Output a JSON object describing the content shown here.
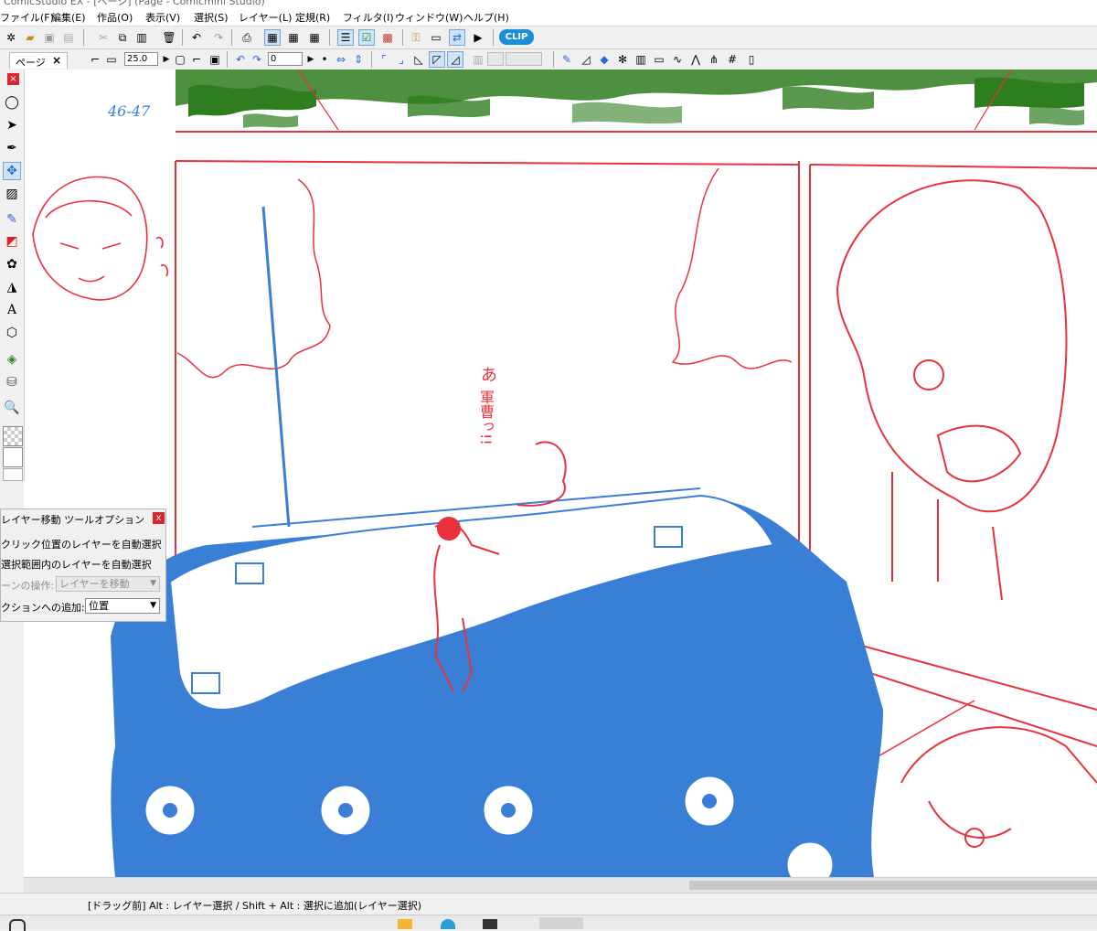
{
  "window": {
    "title": "ComicStudio EX - [ページ] (Page - Comicmini Studio)"
  },
  "menu": [
    "ファイル(F)",
    "編集(E)",
    "作品(O)",
    "表示(V)",
    "選択(S)",
    "レイヤー(L)",
    "定規(R)",
    "フィルタ(I)",
    "ウィンドウ(W)",
    "ヘルプ(H)"
  ],
  "toolbar": {
    "clip_logo": "CLIP"
  },
  "subtoolbar": {
    "zoom_value": "25.0",
    "rotate_value": "0"
  },
  "page_tab": {
    "label": "ページ",
    "close": "×"
  },
  "canvas": {
    "page_note": "46-47",
    "sfx_text_line1": "あ",
    "sfx_text_line2": "軍曹っ!!"
  },
  "tool_options": {
    "title": "レイヤー移動 ツールオプション",
    "close": "x",
    "option1": "クリック位置のレイヤーを自動選択",
    "option2": "選択範囲内のレイヤーを自動選択",
    "field1_label": "ーンの操作:",
    "field1_value": "レイヤーを移動",
    "field2_label": "クションへの追加:",
    "field2_value": "位置"
  },
  "statusbar": {
    "hint": "[ドラッグ前] Alt : レイヤー選択 / Shift + Alt : 選択に追加(レイヤー選択)"
  },
  "colors": {
    "pencil_red": "#e8323c",
    "pencil_blue": "#3a7fd6",
    "background_green": "#2e7d1f",
    "clip_badge": "#1a8fd8"
  }
}
